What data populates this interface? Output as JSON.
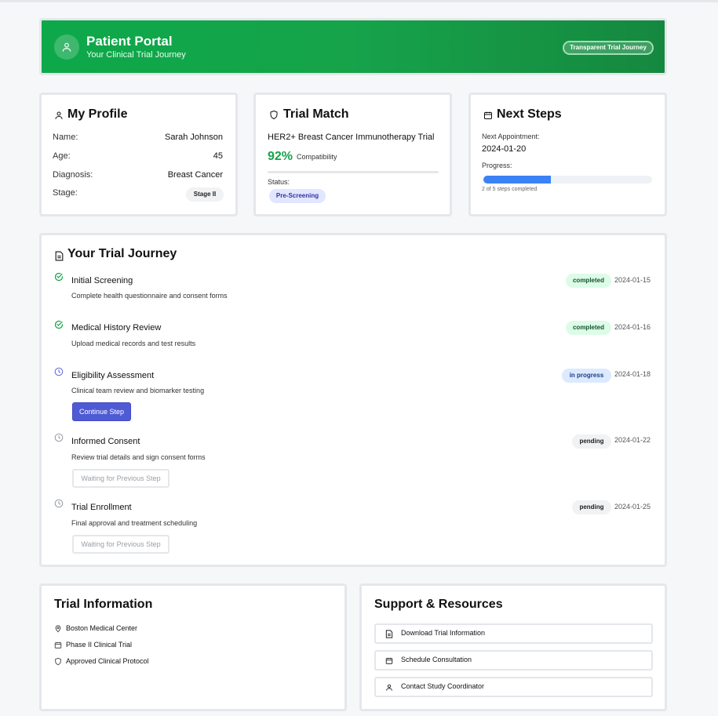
{
  "header": {
    "title": "Patient Portal",
    "subtitle": "Your Clinical Trial Journey",
    "badge": "Transparent Trial Journey"
  },
  "profile": {
    "title": "My Profile",
    "rows": [
      {
        "label": "Name:",
        "value": "Sarah Johnson"
      },
      {
        "label": "Age:",
        "value": "45"
      },
      {
        "label": "Diagnosis:",
        "value": "Breast Cancer"
      },
      {
        "label": "Stage:",
        "value": "Stage II"
      }
    ]
  },
  "trial_match": {
    "title": "Trial Match",
    "trial_name": "HER2+ Breast Cancer Immunotherapy Trial",
    "percent": "92%",
    "compat_label": "Compatibility",
    "compat_fraction": 0.92,
    "status_label": "Status:",
    "status_value": "Pre-Screening"
  },
  "next_steps": {
    "title": "Next Steps",
    "appt_label": "Next Appointment:",
    "appt_date": "2024-01-20",
    "progress_label": "Progress:",
    "progress_fraction": 0.4,
    "progress_text": "2 of 5 steps completed"
  },
  "journey": {
    "title": "Your Trial Journey",
    "steps": [
      {
        "title": "Initial Screening",
        "desc": "Complete health questionnaire and consent forms",
        "status": "completed",
        "date": "2024-01-15"
      },
      {
        "title": "Medical History Review",
        "desc": "Upload medical records and test results",
        "status": "completed",
        "date": "2024-01-16"
      },
      {
        "title": "Eligibility Assessment",
        "desc": "Clinical team review and biomarker testing",
        "status": "in progress",
        "date": "2024-01-18",
        "action": "Continue Step"
      },
      {
        "title": "Informed Consent",
        "desc": "Review trial details and sign consent forms",
        "status": "pending",
        "date": "2024-01-22",
        "action": "Waiting for Previous Step"
      },
      {
        "title": "Trial Enrollment",
        "desc": "Final approval and treatment scheduling",
        "status": "pending",
        "date": "2024-01-25",
        "action": "Waiting for Previous Step"
      }
    ]
  },
  "trial_info": {
    "title": "Trial Information",
    "items": [
      "Boston Medical Center",
      "Phase II Clinical Trial",
      "Approved Clinical Protocol"
    ]
  },
  "support": {
    "title": "Support & Resources",
    "buttons": [
      "Download Trial Information",
      "Schedule Consultation",
      "Contact Study Coordinator"
    ]
  },
  "colors": {
    "header_green": "#16a34a",
    "accent_green": "#16a34a",
    "progress_blue": "#3b82f6",
    "button_indigo": "#4f5bd5"
  }
}
